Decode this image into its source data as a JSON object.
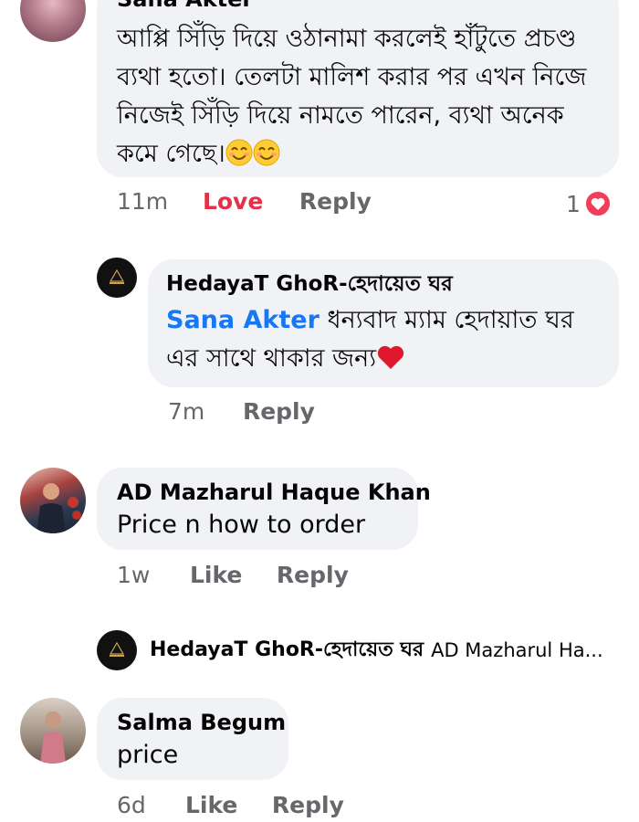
{
  "comments": [
    {
      "author": "Sana Akter",
      "text": "আপ্পি সিঁড়ি দিয়ে ওঠানামা করলেই হাঁটুতে প্রচণ্ড ব্যথা হতো। তেলটা মালিশ করার পর এখন নিজে নিজেই সিঁড়ি দিয়ে নামতে পারেন, ব্যথা অনেক কমে গেছে।",
      "time": "11m",
      "reaction_label": "Love",
      "reply_label": "Reply",
      "reaction_count": "1",
      "reaction_icon": "heart-icon",
      "emoji_icons": [
        "smiling-face-icon",
        "smiling-face-icon"
      ]
    },
    {
      "author": "HedayaT GhoR-হেদায়েত ঘর",
      "mention": "Sana Akter",
      "text": " ধন্যবাদ ম্যাম হেদায়াত ঘর এর সাথে থাকার জন্য",
      "time": "7m",
      "reply_label": "Reply",
      "emoji_icon": "red-heart-icon"
    },
    {
      "author": "AD Mazharul Haque Khan",
      "text": "Price n how to order",
      "time": "1w",
      "like_label": "Like",
      "reply_label": "Reply"
    },
    {
      "author": "HedayaT GhoR-হেদায়েত ঘর",
      "preview": "AD Mazharul Ha..."
    },
    {
      "author": "Salma Begum",
      "text": "price",
      "time": "6d",
      "like_label": "Like",
      "reply_label": "Reply"
    }
  ],
  "colors": {
    "bubble": "#f0f2f5",
    "meta_text": "#65676b",
    "love": "#e4314a",
    "mention": "#1877f2"
  }
}
